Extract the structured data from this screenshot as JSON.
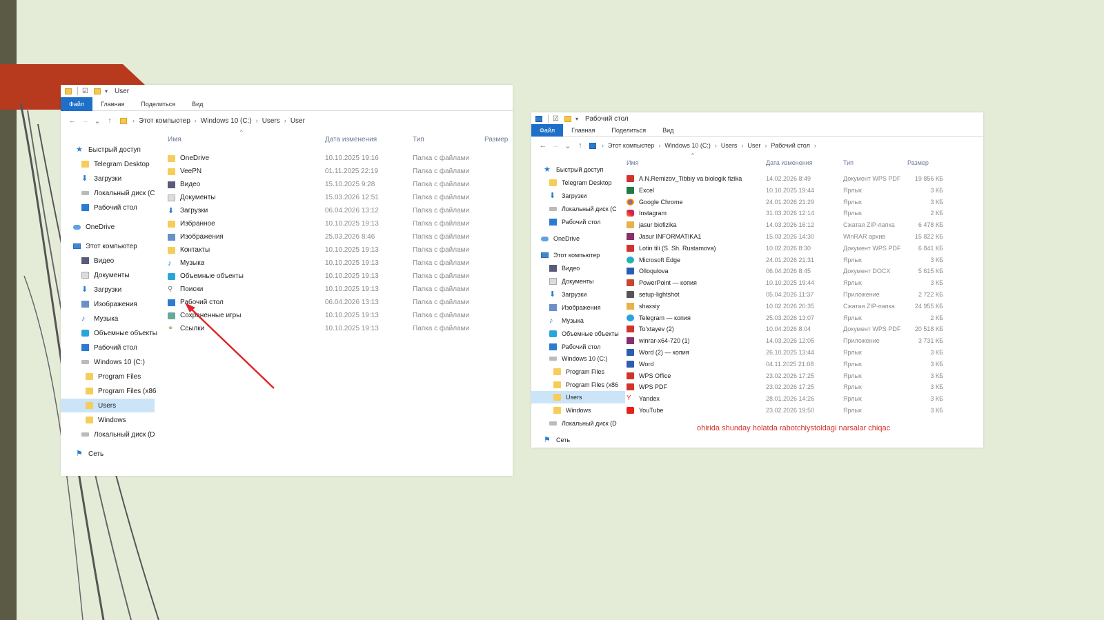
{
  "left_window": {
    "title": "User",
    "ribbon_tabs": [
      "Файл",
      "Главная",
      "Поделиться",
      "Вид"
    ],
    "breadcrumb": [
      "Этот компьютер",
      "Windows 10 (C:)",
      "Users",
      "User"
    ],
    "nav": [
      {
        "label": "Быстрый доступ",
        "icon": "star-icon"
      },
      {
        "label": "Telegram Desktop",
        "icon": "folder-icon"
      },
      {
        "label": "Загрузки",
        "icon": "download-icon"
      },
      {
        "label": "Локальный диск (C",
        "icon": "drive-icon"
      },
      {
        "label": "Рабочий стол",
        "icon": "desktop-icon"
      },
      {
        "label": "OneDrive",
        "icon": "cloud-icon"
      },
      {
        "label": "Этот компьютер",
        "icon": "pc-icon"
      },
      {
        "label": "Видео",
        "icon": "video-icon"
      },
      {
        "label": "Документы",
        "icon": "documents-icon"
      },
      {
        "label": "Загрузки",
        "icon": "download-icon"
      },
      {
        "label": "Изображения",
        "icon": "images-icon"
      },
      {
        "label": "Музыка",
        "icon": "music-icon"
      },
      {
        "label": "Объемные объекты",
        "icon": "3d-objects-icon"
      },
      {
        "label": "Рабочий стол",
        "icon": "desktop-icon"
      },
      {
        "label": "Windows 10 (C:)",
        "icon": "drive-icon"
      },
      {
        "label": "Program Files",
        "icon": "folder-icon"
      },
      {
        "label": "Program Files (x86",
        "icon": "folder-icon"
      },
      {
        "label": "Users",
        "icon": "folder-icon",
        "selected": true
      },
      {
        "label": "Windows",
        "icon": "folder-icon"
      },
      {
        "label": "Локальный диск (D",
        "icon": "drive-icon"
      },
      {
        "label": "Сеть",
        "icon": "network-icon"
      }
    ],
    "columns": [
      "Имя",
      "Дата изменения",
      "Тип",
      "Размер"
    ],
    "files": [
      {
        "name": "OneDrive",
        "date": "10.10.2025 19:16",
        "type": "Папка с файлами",
        "icon": "folder-icon"
      },
      {
        "name": "VeePN",
        "date": "01.11.2025 22:19",
        "type": "Папка с файлами",
        "icon": "folder-icon"
      },
      {
        "name": "Видео",
        "date": "15.10.2025 9:28",
        "type": "Папка с файлами",
        "icon": "video-icon"
      },
      {
        "name": "Документы",
        "date": "15.03.2026 12:51",
        "type": "Папка с файлами",
        "icon": "documents-icon"
      },
      {
        "name": "Загрузки",
        "date": "06.04.2026 13:12",
        "type": "Папка с файлами",
        "icon": "download-icon"
      },
      {
        "name": "Избранное",
        "date": "10.10.2025 19:13",
        "type": "Папка с файлами",
        "icon": "folder-icon"
      },
      {
        "name": "Изображения",
        "date": "25.03.2026 8:46",
        "type": "Папка с файлами",
        "icon": "images-icon"
      },
      {
        "name": "Контакты",
        "date": "10.10.2025 19:13",
        "type": "Папка с файлами",
        "icon": "folder-icon"
      },
      {
        "name": "Музыка",
        "date": "10.10.2025 19:13",
        "type": "Папка с файлами",
        "icon": "music-icon"
      },
      {
        "name": "Объемные объекты",
        "date": "10.10.2025 19:13",
        "type": "Папка с файлами",
        "icon": "3d-objects-icon"
      },
      {
        "name": "Поиски",
        "date": "10.10.2025 19:13",
        "type": "Папка с файлами",
        "icon": "search-icon"
      },
      {
        "name": "Рабочий стол",
        "date": "06.04.2026 13:13",
        "type": "Папка с файлами",
        "icon": "desktop-icon"
      },
      {
        "name": "Сохраненные игры",
        "date": "10.10.2025 19:13",
        "type": "Папка с файлами",
        "icon": "saved-games-icon"
      },
      {
        "name": "Ссылки",
        "date": "10.10.2025 19:13",
        "type": "Папка с файлами",
        "icon": "link-icon"
      }
    ]
  },
  "right_window": {
    "title": "Рабочий стол",
    "ribbon_tabs": [
      "Файл",
      "Главная",
      "Поделиться",
      "Вид"
    ],
    "breadcrumb": [
      "Этот компьютер",
      "Windows 10 (C:)",
      "Users",
      "User",
      "Рабочий стол"
    ],
    "nav": [
      {
        "label": "Быстрый доступ",
        "icon": "star-icon"
      },
      {
        "label": "Telegram Desktop",
        "icon": "folder-icon"
      },
      {
        "label": "Загрузки",
        "icon": "download-icon"
      },
      {
        "label": "Локальный диск (C",
        "icon": "drive-icon"
      },
      {
        "label": "Рабочий стол",
        "icon": "desktop-icon"
      },
      {
        "label": "OneDrive",
        "icon": "cloud-icon"
      },
      {
        "label": "Этот компьютер",
        "icon": "pc-icon"
      },
      {
        "label": "Видео",
        "icon": "video-icon"
      },
      {
        "label": "Документы",
        "icon": "documents-icon"
      },
      {
        "label": "Загрузки",
        "icon": "download-icon"
      },
      {
        "label": "Изображения",
        "icon": "images-icon"
      },
      {
        "label": "Музыка",
        "icon": "music-icon"
      },
      {
        "label": "Объемные объекты",
        "icon": "3d-objects-icon"
      },
      {
        "label": "Рабочий стол",
        "icon": "desktop-icon"
      },
      {
        "label": "Windows 10 (C:)",
        "icon": "drive-icon"
      },
      {
        "label": "Program Files",
        "icon": "folder-icon"
      },
      {
        "label": "Program Files (x86",
        "icon": "folder-icon"
      },
      {
        "label": "Users",
        "icon": "folder-icon",
        "selected": true
      },
      {
        "label": "Windows",
        "icon": "folder-icon"
      },
      {
        "label": "Локальный диск (D",
        "icon": "drive-icon"
      },
      {
        "label": "Сеть",
        "icon": "network-icon"
      }
    ],
    "columns": [
      "Имя",
      "Дата изменения",
      "Тип",
      "Размер"
    ],
    "files": [
      {
        "name": "A.N.Remizov_Tibbiy va biologik fizika",
        "date": "14.02.2026 8:49",
        "type": "Документ WPS PDF",
        "size": "19 856 КБ",
        "icon": "pdf-icon"
      },
      {
        "name": "Excel",
        "date": "10.10.2025 19:44",
        "type": "Ярлык",
        "size": "3 КБ",
        "icon": "excel-icon"
      },
      {
        "name": "Google Chrome",
        "date": "24.01.2026 21:29",
        "type": "Ярлык",
        "size": "3 КБ",
        "icon": "chrome-icon"
      },
      {
        "name": "Instagram",
        "date": "31.03.2026 12:14",
        "type": "Ярлык",
        "size": "2 КБ",
        "icon": "instagram-icon"
      },
      {
        "name": "jasur biofizika",
        "date": "14.03.2026 16:12",
        "type": "Сжатая ZIP-папка",
        "size": "6 478 КБ",
        "icon": "zip-icon"
      },
      {
        "name": "Jasur INFORMATIKA1",
        "date": "15.03.2026 14:30",
        "type": "WinRAR архив",
        "size": "15 822 КБ",
        "icon": "rar-icon"
      },
      {
        "name": "Lotin tili (S. Sh. Rustamova)",
        "date": "10.02.2026 8:30",
        "type": "Документ WPS PDF",
        "size": "6 841 КБ",
        "icon": "pdf-icon"
      },
      {
        "name": "Microsoft Edge",
        "date": "24.01.2026 21:31",
        "type": "Ярлык",
        "size": "3 КБ",
        "icon": "edge-icon"
      },
      {
        "name": "Olloqulova",
        "date": "06.04.2026 8:45",
        "type": "Документ DOCX",
        "size": "5 615 КБ",
        "icon": "word-icon"
      },
      {
        "name": "PowerPoint — копия",
        "date": "10.10.2025 19:44",
        "type": "Ярлык",
        "size": "3 КБ",
        "icon": "powerpoint-icon"
      },
      {
        "name": "setup-lightshot",
        "date": "05.04.2026 11:37",
        "type": "Приложение",
        "size": "2 722 КБ",
        "icon": "app-icon"
      },
      {
        "name": "shaxsiy",
        "date": "10.02.2026 20:35",
        "type": "Сжатая ZIP-папка",
        "size": "24 955 КБ",
        "icon": "zip-icon"
      },
      {
        "name": "Telegram — копия",
        "date": "25.03.2026 13:07",
        "type": "Ярлык",
        "size": "2 КБ",
        "icon": "telegram-icon"
      },
      {
        "name": "To'xtayev (2)",
        "date": "10.04.2026 8:04",
        "type": "Документ WPS PDF",
        "size": "20 518 КБ",
        "icon": "pdf-icon"
      },
      {
        "name": "winrar-x64-720 (1)",
        "date": "14.03.2026 12:05",
        "type": "Приложение",
        "size": "3 731 КБ",
        "icon": "rar-icon"
      },
      {
        "name": "Word (2) — копия",
        "date": "26.10.2025 13:44",
        "type": "Ярлык",
        "size": "3 КБ",
        "icon": "word-icon"
      },
      {
        "name": "Word",
        "date": "04.11.2025 21:08",
        "type": "Ярлык",
        "size": "3 КБ",
        "icon": "word-icon"
      },
      {
        "name": "WPS Office",
        "date": "23.02.2026 17:25",
        "type": "Ярлык",
        "size": "3 КБ",
        "icon": "wps-icon"
      },
      {
        "name": "WPS PDF",
        "date": "23.02.2026 17:25",
        "type": "Ярлык",
        "size": "3 КБ",
        "icon": "wps-pdf-icon"
      },
      {
        "name": "Yandex",
        "date": "28.01.2026 14:26",
        "type": "Ярлык",
        "size": "3 КБ",
        "icon": "yandex-icon"
      },
      {
        "name": "YouTube",
        "date": "23.02.2026 19:50",
        "type": "Ярлык",
        "size": "3 КБ",
        "icon": "youtube-icon"
      }
    ],
    "annotation": "ohirida shunday holatda rabotchiystoldagi narsalar chiqac"
  },
  "colors": {
    "accent": "#1e6fc8",
    "arrow": "#e0262a",
    "slide_red": "#b73a1e",
    "background": "#e4ecd8"
  }
}
